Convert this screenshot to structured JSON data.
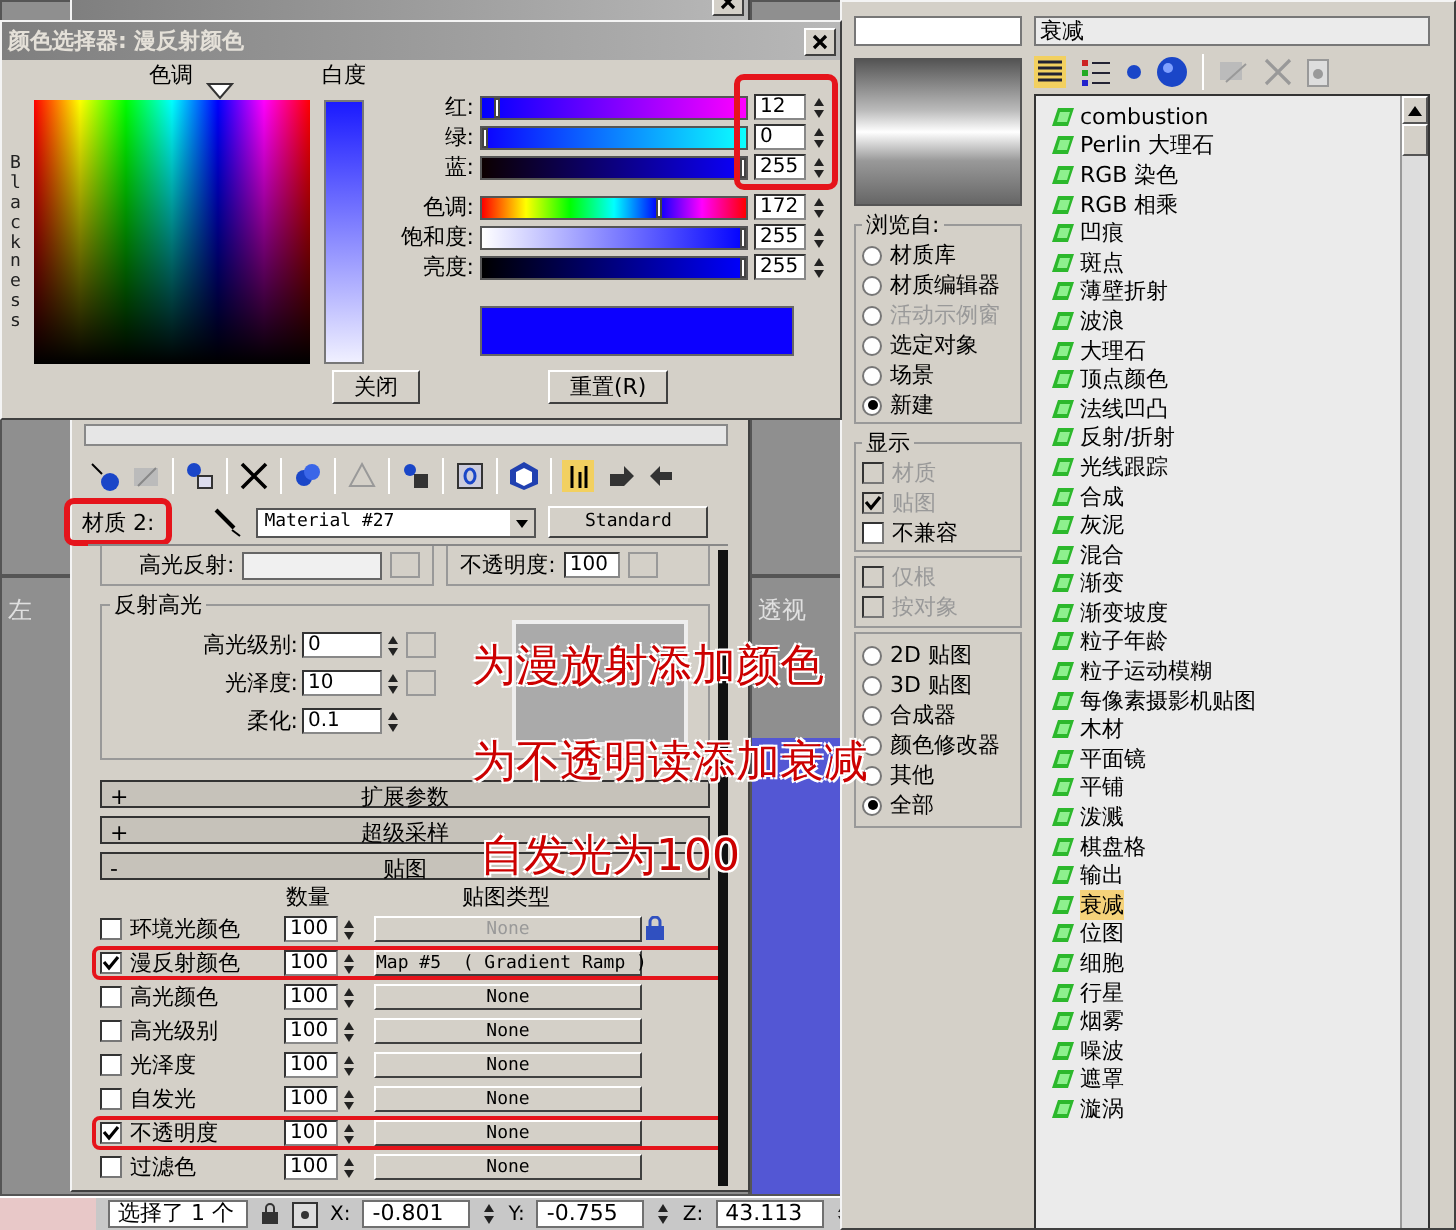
{
  "color_picker": {
    "title": "颜色选择器: 漫反射颜色",
    "hue_label": "色调",
    "whiteness_label": "白度",
    "blackness_label": "Blackness",
    "channels": [
      {
        "label": "红:",
        "value": "12",
        "level": 0.047
      },
      {
        "label": "绿:",
        "value": "0",
        "level": 0
      },
      {
        "label": "蓝:",
        "value": "255",
        "level": 1
      },
      {
        "label": "色调:",
        "value": "172",
        "level": 0.675
      },
      {
        "label": "饱和度:",
        "value": "255",
        "level": 1
      },
      {
        "label": "亮度:",
        "value": "255",
        "level": 1
      }
    ],
    "buttons": [
      "关闭",
      "重置(R)"
    ]
  },
  "material_editor": {
    "material_label": "材质 2:",
    "material_name": "Material #27",
    "type_button": "Standard",
    "partial_row": {
      "specular_label": "高光反射:",
      "opacity_label": "不透明度:",
      "opacity_value": "100"
    },
    "specular_highlights": {
      "title": "反射高光",
      "fields": [
        {
          "label": "高光级别:",
          "value": "0"
        },
        {
          "label": "光泽度:",
          "value": "10"
        },
        {
          "label": "柔化:",
          "value": "0.1"
        }
      ]
    },
    "rollouts": [
      {
        "sign": "+",
        "title": "扩展参数"
      },
      {
        "sign": "+",
        "title": "超级采样"
      },
      {
        "sign": "-",
        "title": "贴图"
      }
    ],
    "maps": {
      "columns": [
        "数量",
        "贴图类型"
      ],
      "rows": [
        {
          "name": "环境光颜色",
          "checked": false,
          "amount": "100",
          "map": "None",
          "dimmed": true
        },
        {
          "name": "漫反射颜色",
          "checked": true,
          "amount": "100",
          "map": "Map #5  ( Gradient Ramp )",
          "dimmed": false
        },
        {
          "name": "高光颜色",
          "checked": false,
          "amount": "100",
          "map": "None",
          "dimmed": false
        },
        {
          "name": "高光级别",
          "checked": false,
          "amount": "100",
          "map": "None",
          "dimmed": false
        },
        {
          "name": "光泽度",
          "checked": false,
          "amount": "100",
          "map": "None",
          "dimmed": false
        },
        {
          "name": "自发光",
          "checked": false,
          "amount": "100",
          "map": "None",
          "dimmed": false
        },
        {
          "name": "不透明度",
          "checked": true,
          "amount": "100",
          "map": "None",
          "dimmed": false
        },
        {
          "name": "过滤色",
          "checked": false,
          "amount": "100",
          "map": "None",
          "dimmed": false
        }
      ]
    }
  },
  "viewports": [
    {
      "label": "左"
    },
    {
      "label": "透视"
    }
  ],
  "annotations": [
    {
      "text": "为漫放射添加颜色"
    },
    {
      "text": "为不透明读添加衰减"
    },
    {
      "text": "自发光为100"
    }
  ],
  "status_bar": {
    "selection": "选择了 1 个",
    "coords": [
      {
        "axis": "X:",
        "value": "-0.801"
      },
      {
        "axis": "Y:",
        "value": "-0.755"
      },
      {
        "axis": "Z:",
        "value": "43.113"
      }
    ]
  },
  "browser": {
    "name_field": "衰减",
    "browse_from": {
      "title": "浏览自:",
      "options": [
        {
          "label": "材质库",
          "selected": false,
          "disabled": false
        },
        {
          "label": "材质编辑器",
          "selected": false,
          "disabled": false
        },
        {
          "label": "活动示例窗",
          "selected": false,
          "disabled": true
        },
        {
          "label": "选定对象",
          "selected": false,
          "disabled": false
        },
        {
          "label": "场景",
          "selected": false,
          "disabled": false
        },
        {
          "label": "新建",
          "selected": true,
          "disabled": false
        }
      ]
    },
    "show": {
      "title": "显示",
      "options": [
        {
          "label": "材质",
          "checked": false,
          "disabled": true
        },
        {
          "label": "贴图",
          "checked": true,
          "disabled": true
        },
        {
          "label": "不兼容",
          "checked": false,
          "disabled": false
        }
      ]
    },
    "filters": [
      {
        "label": "仅根",
        "checked": false,
        "disabled": true
      },
      {
        "label": "按对象",
        "checked": false,
        "disabled": true
      }
    ],
    "categories": [
      {
        "label": "2D 贴图",
        "selected": false
      },
      {
        "label": "3D 贴图",
        "selected": false
      },
      {
        "label": "合成器",
        "selected": false
      },
      {
        "label": "颜色修改器",
        "selected": false
      },
      {
        "label": "其他",
        "selected": false
      },
      {
        "label": "全部",
        "selected": true
      }
    ],
    "items": [
      {
        "label": "combustion",
        "selected": false
      },
      {
        "label": "Perlin 大理石",
        "selected": false
      },
      {
        "label": "RGB 染色",
        "selected": false
      },
      {
        "label": "RGB 相乘",
        "selected": false
      },
      {
        "label": "凹痕",
        "selected": false
      },
      {
        "label": "斑点",
        "selected": false
      },
      {
        "label": "薄壁折射",
        "selected": false
      },
      {
        "label": "波浪",
        "selected": false
      },
      {
        "label": "大理石",
        "selected": false
      },
      {
        "label": "顶点颜色",
        "selected": false
      },
      {
        "label": "法线凹凸",
        "selected": false
      },
      {
        "label": "反射/折射",
        "selected": false
      },
      {
        "label": "光线跟踪",
        "selected": false
      },
      {
        "label": "合成",
        "selected": false
      },
      {
        "label": "灰泥",
        "selected": false
      },
      {
        "label": "混合",
        "selected": false
      },
      {
        "label": "渐变",
        "selected": false
      },
      {
        "label": "渐变坡度",
        "selected": false
      },
      {
        "label": "粒子年龄",
        "selected": false
      },
      {
        "label": "粒子运动模糊",
        "selected": false
      },
      {
        "label": "每像素摄影机贴图",
        "selected": false
      },
      {
        "label": "木材",
        "selected": false
      },
      {
        "label": "平面镜",
        "selected": false
      },
      {
        "label": "平铺",
        "selected": false
      },
      {
        "label": "泼溅",
        "selected": false
      },
      {
        "label": "棋盘格",
        "selected": false
      },
      {
        "label": "输出",
        "selected": false
      },
      {
        "label": "衰减",
        "selected": true
      },
      {
        "label": "位图",
        "selected": false
      },
      {
        "label": "细胞",
        "selected": false
      },
      {
        "label": "行星",
        "selected": false
      },
      {
        "label": "烟雾",
        "selected": false
      },
      {
        "label": "噪波",
        "selected": false
      },
      {
        "label": "遮罩",
        "selected": false
      },
      {
        "label": "漩涡",
        "selected": false
      }
    ]
  }
}
